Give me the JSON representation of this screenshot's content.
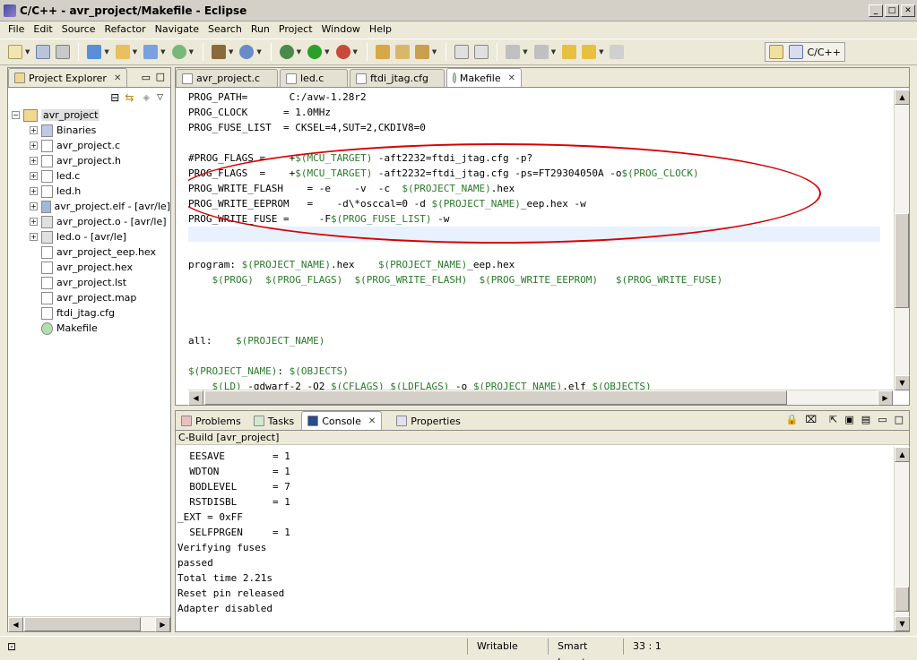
{
  "window": {
    "title": "C/C++ - avr_project/Makefile - Eclipse"
  },
  "menu": [
    "File",
    "Edit",
    "Source",
    "Refactor",
    "Navigate",
    "Search",
    "Run",
    "Project",
    "Window",
    "Help"
  ],
  "perspective": {
    "label": "C/C++"
  },
  "explorer": {
    "tab": "Project Explorer",
    "tree": [
      {
        "label": "avr_project",
        "icon": "project-icon",
        "expander": "−",
        "level": 0
      },
      {
        "label": "Binaries",
        "icon": "binaries-icon",
        "expander": "+",
        "level": 1
      },
      {
        "label": "avr_project.c",
        "icon": "c-file-icon",
        "expander": "+",
        "level": 1
      },
      {
        "label": "avr_project.h",
        "icon": "h-file-icon",
        "expander": "+",
        "level": 1
      },
      {
        "label": "led.c",
        "icon": "c-file-icon",
        "expander": "+",
        "level": 1
      },
      {
        "label": "led.h",
        "icon": "h-file-icon",
        "expander": "+",
        "level": 1
      },
      {
        "label": "avr_project.elf - [avr/le]",
        "icon": "elf-icon",
        "expander": "+",
        "level": 1
      },
      {
        "label": "avr_project.o - [avr/le]",
        "icon": "obj-icon",
        "expander": "+",
        "level": 1
      },
      {
        "label": "led.o - [avr/le]",
        "icon": "obj-icon",
        "expander": "+",
        "level": 1
      },
      {
        "label": "avr_project_eep.hex",
        "icon": "file-icon",
        "expander": "",
        "level": 1
      },
      {
        "label": "avr_project.hex",
        "icon": "file-icon",
        "expander": "",
        "level": 1
      },
      {
        "label": "avr_project.lst",
        "icon": "file-icon",
        "expander": "",
        "level": 1
      },
      {
        "label": "avr_project.map",
        "icon": "file-icon",
        "expander": "",
        "level": 1
      },
      {
        "label": "ftdi_jtag.cfg",
        "icon": "file-icon",
        "expander": "",
        "level": 1
      },
      {
        "label": "Makefile",
        "icon": "makefile-icon",
        "expander": "",
        "level": 1
      }
    ]
  },
  "editor": {
    "tabs": [
      "avr_project.c",
      "led.c",
      "ftdi_jtag.cfg",
      "Makefile"
    ],
    "active_tab": "Makefile",
    "lines": [
      "PROG_PATH=       C:/avw-1.28r2",
      "PROG_CLOCK      = 1.0MHz",
      "PROG_FUSE_LIST  = CKSEL=4,SUT=2,CKDIV8=0",
      "",
      "#PROG_FLAGS =    +$(MCU_TARGET) -aft2232=ftdi_jtag.cfg -p?",
      "PROG_FLAGS  =    +$(MCU_TARGET) -aft2232=ftdi_jtag.cfg -ps=FT29304050A -o$(PROG_CLOCK)",
      "PROG_WRITE_FLASH    = -e    -v  -c  $(PROJECT_NAME).hex",
      "PROG_WRITE_EEPROM   =    -d\\*osccal=0 -d $(PROJECT_NAME)_eep.hex -w",
      "PROG_WRITE_FUSE =     -F$(PROG_FUSE_LIST) -w",
      "",
      "",
      "program: $(PROJECT_NAME).hex    $(PROJECT_NAME)_eep.hex",
      "    $(PROG)  $(PROG_FLAGS)  $(PROG_WRITE_FLASH)  $(PROG_WRITE_EEPROM)   $(PROG_WRITE_FUSE)",
      "",
      "",
      "",
      "all:    $(PROJECT_NAME)",
      "",
      "$(PROJECT_NAME): $(OBJECTS)",
      "    $(LD) -gdwarf-2 -O2 $(CFLAGS) $(LDFLAGS) -o $(PROJECT_NAME).elf $(OBJECTS)"
    ],
    "current_line": 9
  },
  "bottom": {
    "tabs": [
      "Problems",
      "Tasks",
      "Console",
      "Properties"
    ],
    "active_tab": "Console",
    "console_label": "C-Build [avr_project]",
    "console_lines": [
      "  EESAVE        = 1",
      "  WDTON         = 1",
      "  BODLEVEL      = 7",
      "  RSTDISBL      = 1",
      "_EXT = 0xFF",
      "  SELFPRGEN     = 1",
      "Verifying fuses",
      "passed",
      "Total time 2.21s",
      "Reset pin released",
      "Adapter disabled"
    ]
  },
  "status": {
    "writable": "Writable",
    "insert_mode": "Smart Insert",
    "position": "33 : 1"
  },
  "colors": {
    "variable": "#2a7a2a",
    "oval": "#d80000",
    "current_line": "#e8f2fe"
  }
}
